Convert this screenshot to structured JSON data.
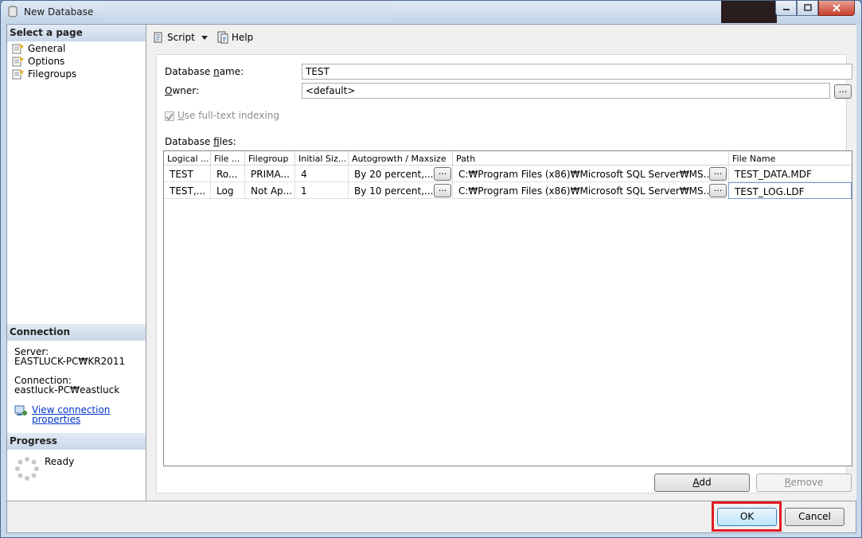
{
  "window": {
    "title": "New Database"
  },
  "left_panel": {
    "select_page_header": "Select a page",
    "pages": [
      {
        "label": "General"
      },
      {
        "label": "Options"
      },
      {
        "label": "Filegroups"
      }
    ],
    "connection_header": "Connection",
    "server_label": "Server:",
    "server_value": "EASTLUCK-PC₩KR2011",
    "connection_label": "Connection:",
    "connection_value": "eastluck-PC₩eastluck",
    "view_connection_line1": "View connection",
    "view_connection_line2": "properties",
    "progress_header": "Progress",
    "progress_status": "Ready"
  },
  "toolbar": {
    "script_label": "Script",
    "help_label": "Help"
  },
  "form": {
    "db_name_label_pre": "Database ",
    "db_name_label_u": "n",
    "db_name_label_post": "ame:",
    "db_name_value": "TEST",
    "owner_label_u": "O",
    "owner_label_post": "wner:",
    "owner_value": "<default>",
    "browse_label": "...",
    "fulltext_label_u": "U",
    "fulltext_label_post": "se full-text indexing",
    "fulltext_checked": true,
    "db_files_label_pre": "Database ",
    "db_files_label_u": "f",
    "db_files_label_post": "iles:"
  },
  "grid": {
    "columns": [
      "Logical ...",
      "File ...",
      "Filegroup",
      "Initial Siz...",
      "Autogrowth / Maxsize",
      "Path",
      "File Name"
    ],
    "rows": [
      {
        "logical": "TEST",
        "type": "Ro...",
        "filegroup": "PRIMA...",
        "size": "4",
        "autogrowth": "By 20 percent,...",
        "path": "C:₩Program Files (x86)₩Microsoft SQL Server₩MS...",
        "filename": "TEST_DATA.MDF"
      },
      {
        "logical": "TEST,...",
        "type": "Log",
        "filegroup": "Not Ap...",
        "size": "1",
        "autogrowth": "By 10 percent,...",
        "path": "C:₩Program Files (x86)₩Microsoft SQL Server₩MS...",
        "filename": "TEST_LOG.LDF"
      }
    ],
    "cell_button": "..."
  },
  "buttons": {
    "add_u": "A",
    "add_post": "dd",
    "remove_u": "R",
    "remove_post": "emove",
    "ok": "OK",
    "cancel": "Cancel"
  },
  "colors": {
    "highlight": "#e01b24",
    "link": "#0033cc",
    "section_header": "#c9d7e8"
  }
}
